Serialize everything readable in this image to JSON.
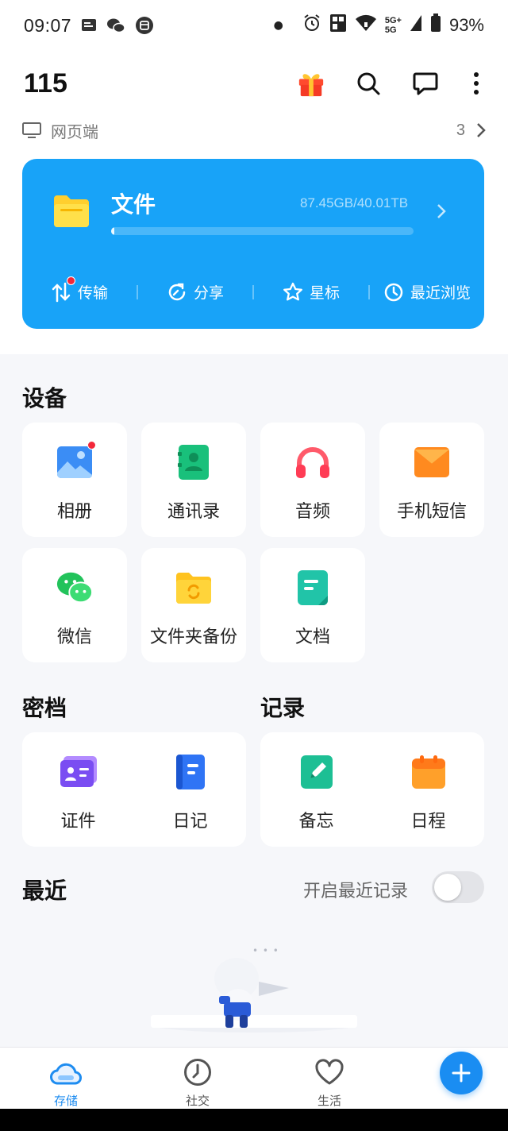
{
  "status_bar": {
    "time": "09:07",
    "network_top": "5G+",
    "network_bottom": "5G",
    "battery": "93%"
  },
  "header": {
    "title": "115"
  },
  "web_row": {
    "label": "网页端",
    "count": "3"
  },
  "files_card": {
    "title": "文件",
    "usage": "87.45GB/40.01TB",
    "usage_fraction": 0.0022,
    "colors": {
      "card": "#18a3f8",
      "folder": "#ffcf2e"
    },
    "quick_actions": [
      {
        "label": "传输",
        "icon": "transfer-icon",
        "badge": true
      },
      {
        "label": "分享",
        "icon": "share-icon",
        "badge": false
      },
      {
        "label": "星标",
        "icon": "star-icon",
        "badge": false
      },
      {
        "label": "最近浏览",
        "icon": "history-icon",
        "badge": false
      }
    ]
  },
  "devices": {
    "title": "设备",
    "items": [
      {
        "label": "相册",
        "icon": "photo-album-icon",
        "badge": true
      },
      {
        "label": "通讯录",
        "icon": "contacts-icon",
        "badge": false
      },
      {
        "label": "音频",
        "icon": "headphones-icon",
        "badge": false
      },
      {
        "label": "手机短信",
        "icon": "sms-envelope-icon",
        "badge": false
      },
      {
        "label": "微信",
        "icon": "wechat-icon",
        "badge": false
      },
      {
        "label": "文件夹备份",
        "icon": "folder-backup-icon",
        "badge": false
      },
      {
        "label": "文档",
        "icon": "document-icon",
        "badge": false
      }
    ]
  },
  "vault": {
    "title": "密档",
    "items": [
      {
        "label": "证件",
        "icon": "id-card-icon"
      },
      {
        "label": "日记",
        "icon": "diary-icon"
      }
    ]
  },
  "records": {
    "title": "记录",
    "items": [
      {
        "label": "备忘",
        "icon": "memo-icon"
      },
      {
        "label": "日程",
        "icon": "calendar-icon"
      }
    ]
  },
  "recent": {
    "title": "最近",
    "toggle_label": "开启最近记录",
    "toggle_on": false,
    "loading_dots": "• • •"
  },
  "bottom_nav": {
    "items": [
      {
        "label": "存储",
        "icon": "cloud-storage-icon",
        "active": true
      },
      {
        "label": "社交",
        "icon": "clock-icon",
        "active": false
      },
      {
        "label": "生活",
        "icon": "heart-icon",
        "active": false
      }
    ],
    "fab": {
      "icon": "plus-icon"
    },
    "accent": "#1a8df2"
  }
}
